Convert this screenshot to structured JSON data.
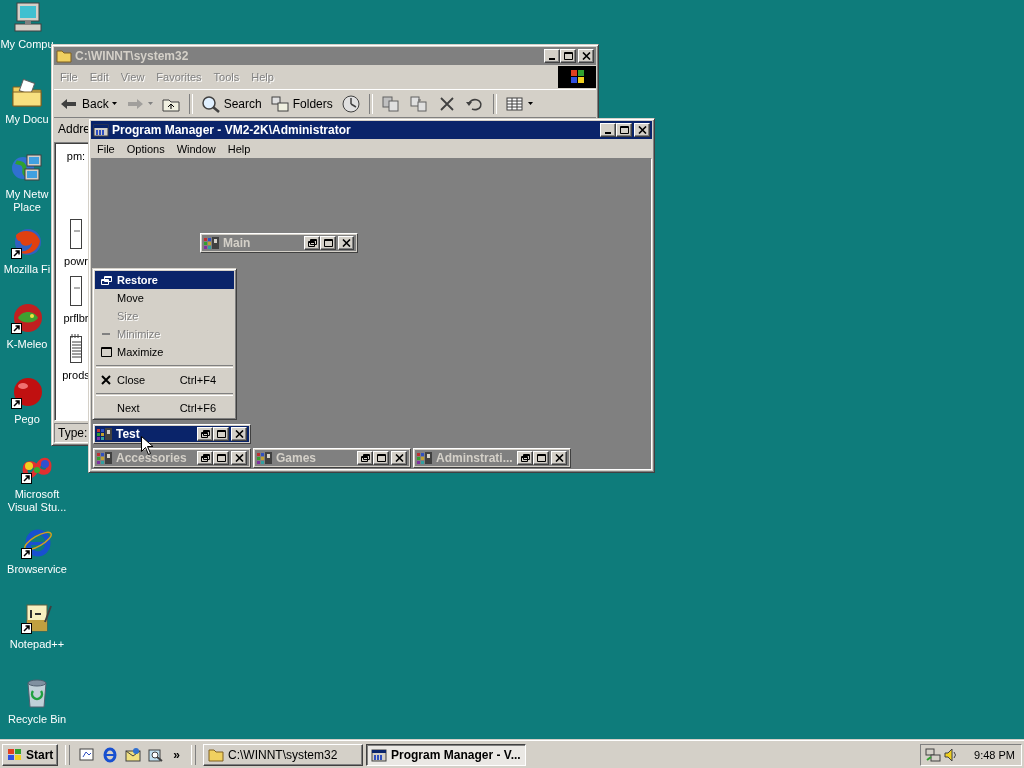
{
  "desktop_icons": [
    {
      "kind": "computer",
      "lines": [
        "My Compu"
      ],
      "shortcut": false
    },
    {
      "kind": "documents",
      "lines": [
        "My Docu"
      ],
      "shortcut": false
    },
    {
      "kind": "network",
      "lines": [
        "My Netw",
        "Place"
      ],
      "shortcut": false
    },
    {
      "kind": "firefox",
      "lines": [
        "Mozilla Fi"
      ],
      "shortcut": true
    },
    {
      "kind": "kmeleon",
      "lines": [
        "K-Meleo"
      ],
      "shortcut": true
    },
    {
      "kind": "pego",
      "lines": [
        "Pego"
      ],
      "shortcut": true
    },
    {
      "kind": "visualstudio",
      "lines": [
        "Microsoft",
        "Visual Stu..."
      ],
      "shortcut": true
    },
    {
      "kind": "ie",
      "lines": [
        "Browservice"
      ],
      "shortcut": true
    },
    {
      "kind": "notepad",
      "lines": [
        "Notepad++"
      ],
      "shortcut": true
    },
    {
      "kind": "recycle",
      "lines": [
        "Recycle Bin"
      ],
      "shortcut": false
    }
  ],
  "explorer": {
    "title": "C:\\WINNT\\system32",
    "active": false,
    "menu": [
      {
        "label": "File",
        "disabled": true
      },
      {
        "label": "Edit",
        "disabled": true
      },
      {
        "label": "View",
        "disabled": true
      },
      {
        "label": "Favorites",
        "disabled": true
      },
      {
        "label": "Tools",
        "disabled": true
      },
      {
        "label": "Help",
        "disabled": true
      }
    ],
    "toolbar": [
      {
        "kind": "back",
        "label": "Back",
        "dropdown": true,
        "disabled": false
      },
      {
        "kind": "forward",
        "dropdown": true,
        "disabled": true
      },
      {
        "kind": "up",
        "disabled": false
      },
      {
        "kind": "separator"
      },
      {
        "kind": "search",
        "label": "Search",
        "disabled": false
      },
      {
        "kind": "folders",
        "label": "Folders",
        "disabled": false
      },
      {
        "kind": "history",
        "disabled": false
      },
      {
        "kind": "separator"
      },
      {
        "kind": "move",
        "disabled": false
      },
      {
        "kind": "copy",
        "disabled": false
      },
      {
        "kind": "delete",
        "disabled": false
      },
      {
        "kind": "undo",
        "disabled": false
      },
      {
        "kind": "separator"
      },
      {
        "kind": "views",
        "dropdown": true,
        "disabled": false
      }
    ],
    "address_label": "Addre",
    "files": [
      {
        "label": "pm:",
        "kind": "hidden"
      },
      {
        "label": "powr",
        "kind": "document"
      },
      {
        "label": "prflbr",
        "kind": "document"
      },
      {
        "label": "prods",
        "kind": "notes"
      }
    ],
    "status": "Type:"
  },
  "program_manager": {
    "title": "Program Manager - VM2-2K\\Administrator",
    "active": true,
    "menu": [
      "File",
      "Options",
      "Window",
      "Help"
    ],
    "groups": [
      {
        "title": "Main",
        "active": false
      },
      {
        "title": "Test",
        "active": true
      },
      {
        "title": "Accessories",
        "active": false
      },
      {
        "title": "Games",
        "active": false
      },
      {
        "title": "Adminstrati...",
        "active": false
      }
    ],
    "system_menu": [
      {
        "kind": "restore",
        "label": "Restore",
        "selected": true,
        "disabled": false
      },
      {
        "kind": "move",
        "label": "Move",
        "selected": false,
        "disabled": false
      },
      {
        "kind": "size",
        "label": "Size",
        "selected": false,
        "disabled": true
      },
      {
        "kind": "minimize",
        "label": "Minimize",
        "selected": false,
        "disabled": true
      },
      {
        "kind": "maximize",
        "label": "Maximize",
        "selected": false,
        "disabled": false
      },
      {
        "kind": "separator"
      },
      {
        "kind": "close",
        "label": "Close",
        "shortcut": "Ctrl+F4",
        "selected": false,
        "disabled": false
      },
      {
        "kind": "separator"
      },
      {
        "kind": "next",
        "label": "Next",
        "shortcut": "Ctrl+F6",
        "selected": false,
        "disabled": false
      }
    ]
  },
  "taskbar": {
    "start": "Start",
    "quick_launch": [
      {
        "kind": "desktop"
      },
      {
        "kind": "ie"
      },
      {
        "kind": "outlook"
      },
      {
        "kind": "search"
      }
    ],
    "chevron": "»",
    "tasks": [
      {
        "kind": "folder",
        "label": "C:\\WINNT\\system32",
        "selected": false
      },
      {
        "kind": "progman",
        "label": "Program Manager - V...",
        "selected": true
      }
    ],
    "tray": [
      {
        "kind": "network"
      },
      {
        "kind": "volume"
      }
    ],
    "clock": "9:48 PM"
  }
}
